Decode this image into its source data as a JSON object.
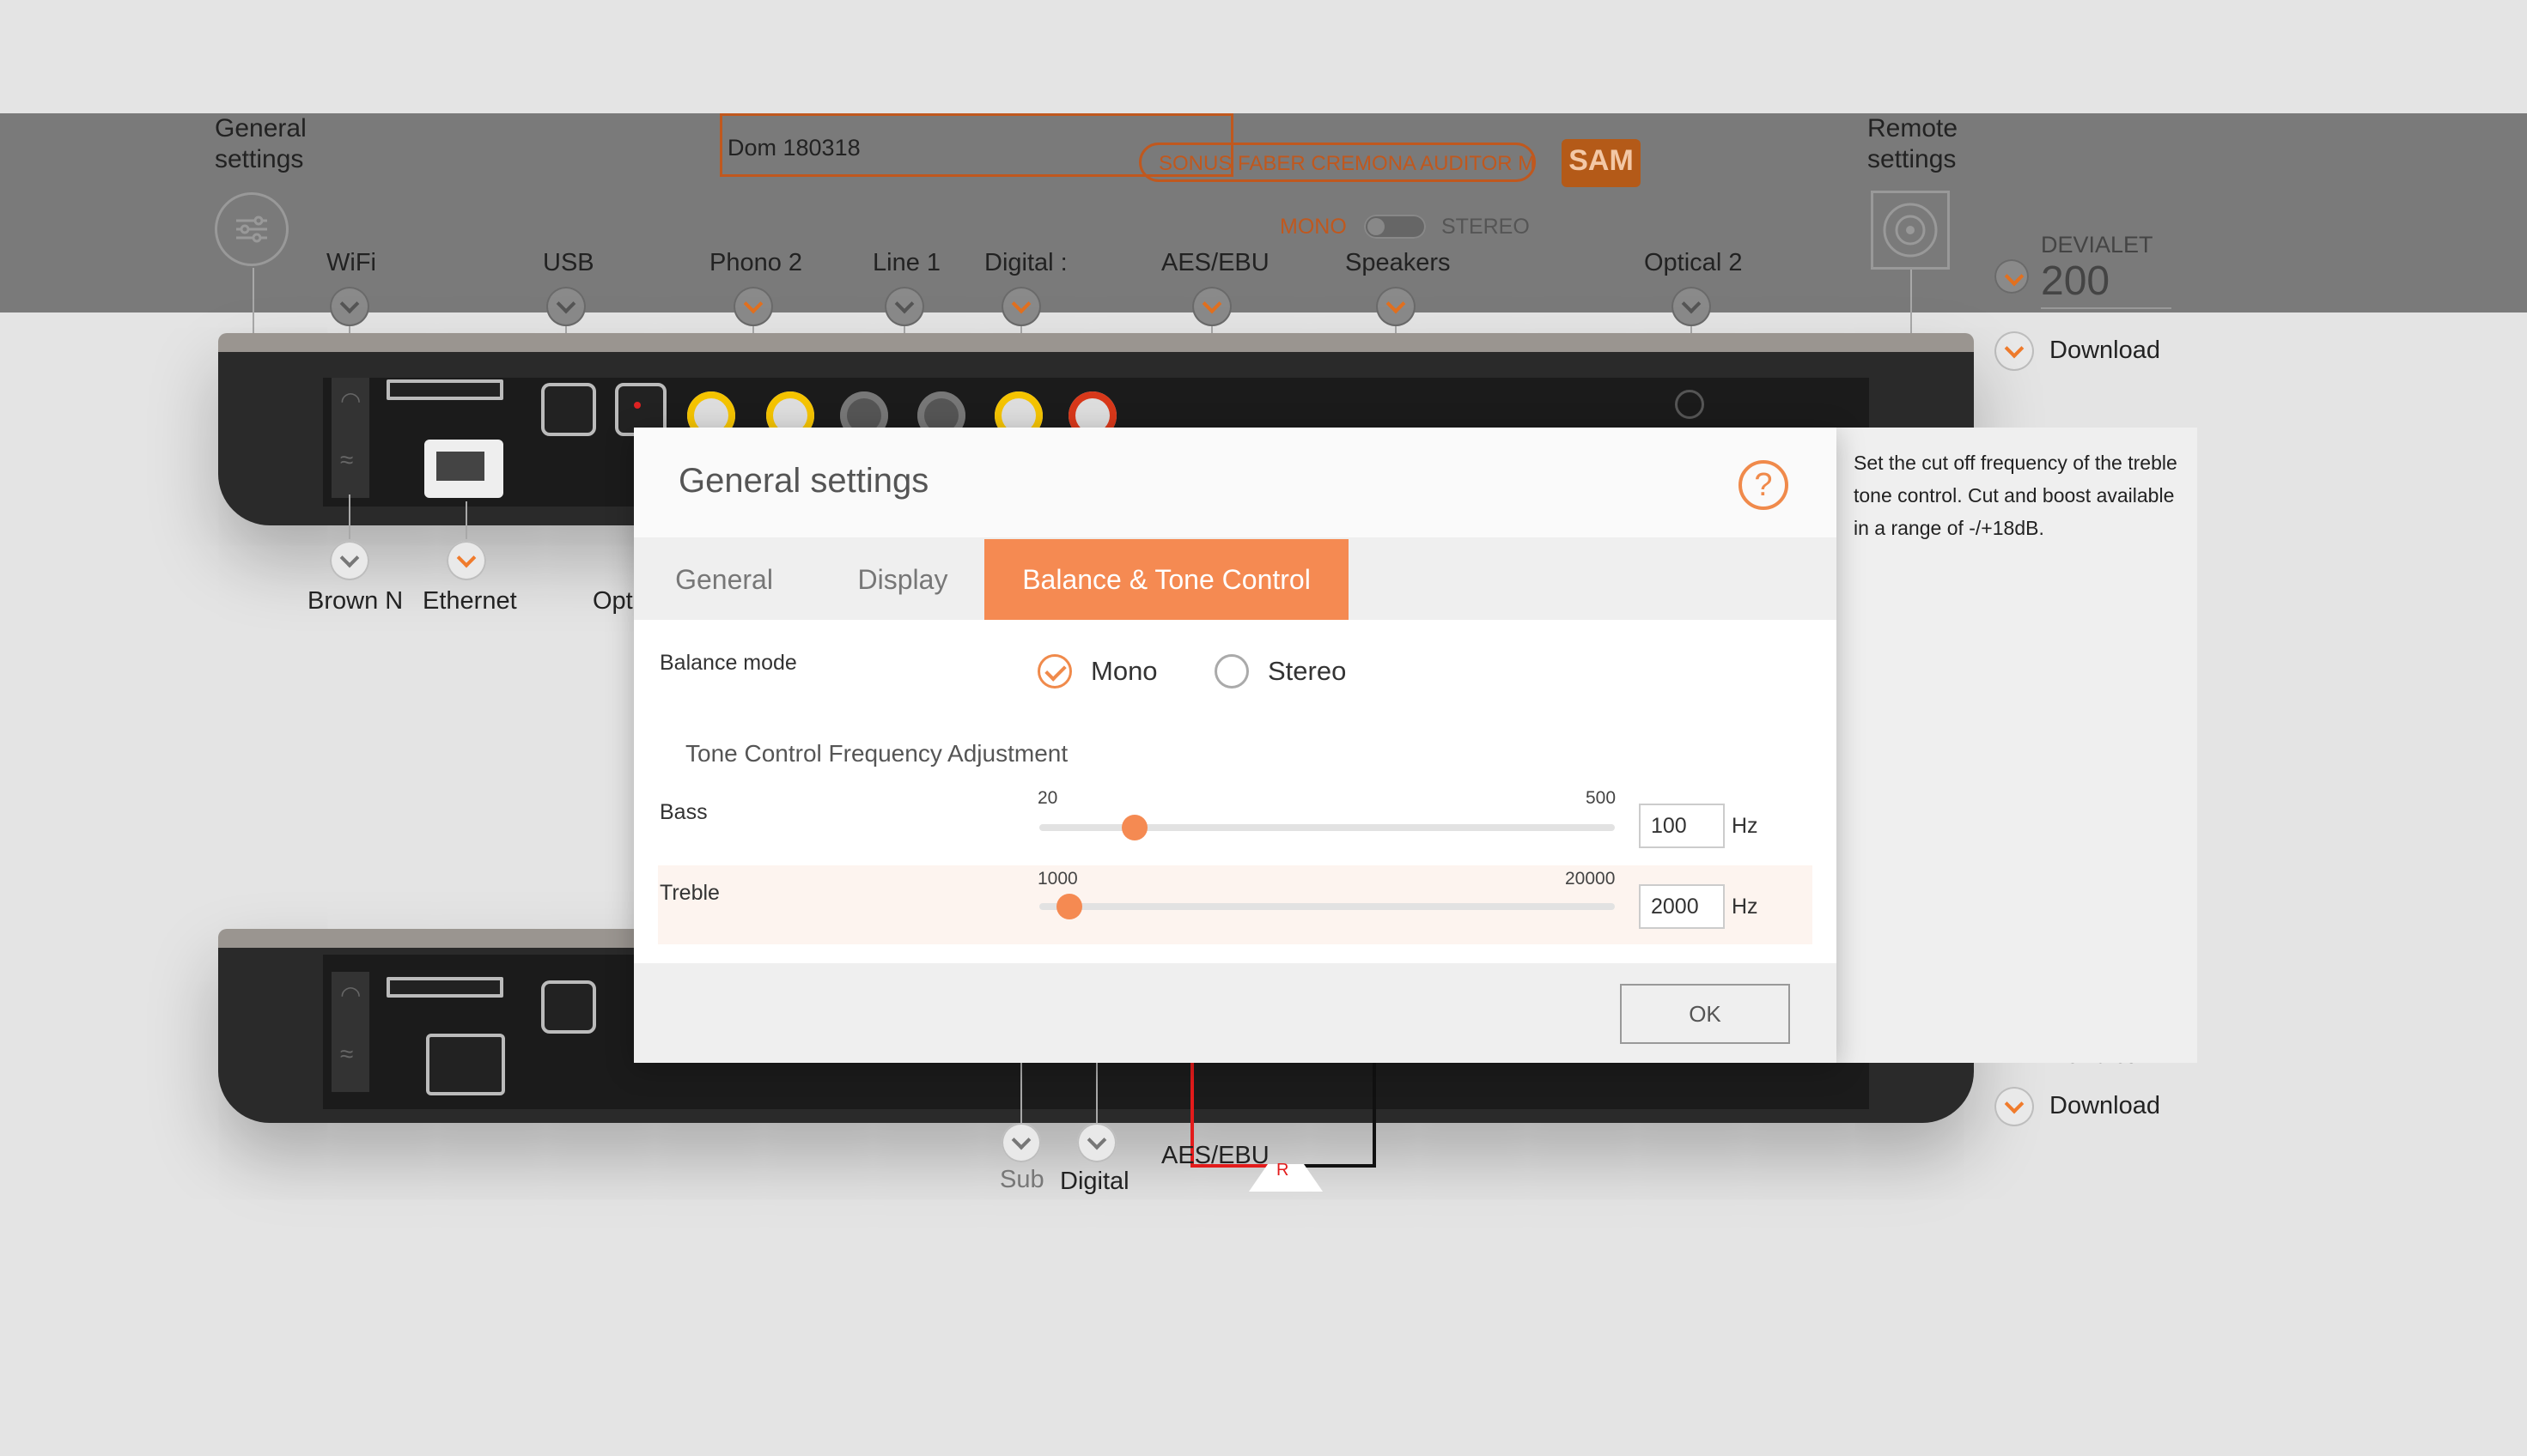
{
  "header": {
    "general_settings_label": "General\nsettings",
    "remote_settings_label": "Remote\nsettings",
    "config_name": "Dom 180318",
    "speaker_model": "SONUS FABER CREMONA AUDITOR M",
    "sam_logo": "SAM",
    "mono_label": "MONO",
    "stereo_label": "STEREO",
    "brand": "DEVIALET",
    "model_number": "200",
    "download_top": "Download",
    "download_bottom": "Download",
    "devialet_partial": "Devialet"
  },
  "top_ports": [
    {
      "label": "WiFi",
      "active": false
    },
    {
      "label": "USB",
      "active": false
    },
    {
      "label": "Phono 2",
      "active": true
    },
    {
      "label": "Line 1",
      "active": false
    },
    {
      "label": "Digital :",
      "active": true
    },
    {
      "label": "AES/EBU",
      "active": true
    },
    {
      "label": "Speakers",
      "active": true
    },
    {
      "label": "Optical 2",
      "active": false
    }
  ],
  "bottom_ports_upper": [
    {
      "label": "Brown N",
      "active": false
    },
    {
      "label": "Ethernet",
      "active": true
    },
    {
      "label": "Opt",
      "active": false
    }
  ],
  "bottom_ports_lower": [
    {
      "label": "Sub"
    },
    {
      "label": "Digital"
    },
    {
      "label": "AES/EBU"
    }
  ],
  "speaker_channel": "R",
  "dialog": {
    "title": "General settings",
    "help_icon": "?",
    "tabs": [
      {
        "label": "General",
        "active": false
      },
      {
        "label": "Display",
        "active": false
      },
      {
        "label": "Balance & Tone Control",
        "active": true
      }
    ],
    "balance_mode_label": "Balance mode",
    "balance_options": [
      {
        "label": "Mono",
        "selected": true
      },
      {
        "label": "Stereo",
        "selected": false
      }
    ],
    "section_title": "Tone Control Frequency Adjustment",
    "bass": {
      "label": "Bass",
      "min": "20",
      "max": "500",
      "value": "100",
      "unit": "Hz",
      "position": 0.165
    },
    "treble": {
      "label": "Treble",
      "min": "1000",
      "max": "20000",
      "value": "2000",
      "unit": "Hz",
      "position": 0.052
    },
    "ok_label": "OK"
  },
  "help_text": "Set the cut off frequency of the treble tone control. Cut and boost available in a range of -/+18dB.",
  "colors": {
    "accent": "#f58a52",
    "band": "#7a7a7a",
    "background": "#e4e4e4"
  }
}
